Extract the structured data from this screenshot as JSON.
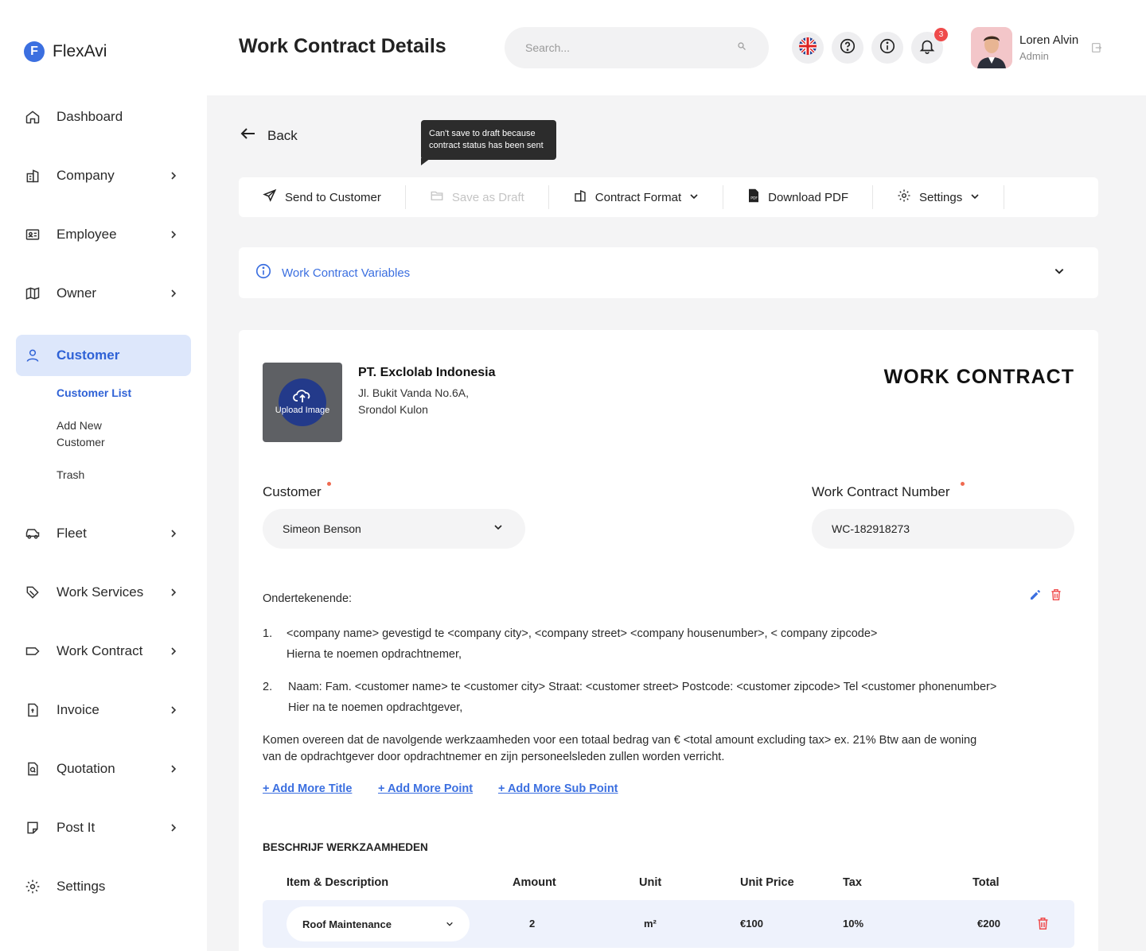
{
  "app": {
    "logo_letter": "F",
    "name": "FlexAvi"
  },
  "sidebar": {
    "items": [
      {
        "label": "Dashboard",
        "icon": "home-icon"
      },
      {
        "label": "Company",
        "icon": "building-icon"
      },
      {
        "label": "Employee",
        "icon": "id-card-icon"
      },
      {
        "label": "Owner",
        "icon": "map-icon"
      },
      {
        "label": "Customer",
        "icon": "user-icon"
      },
      {
        "label": "Fleet",
        "icon": "car-icon"
      },
      {
        "label": "Work Services",
        "icon": "tag-tools-icon"
      },
      {
        "label": "Work Contract",
        "icon": "label-icon"
      },
      {
        "label": "Invoice",
        "icon": "invoice-icon"
      },
      {
        "label": "Quotation",
        "icon": "quotation-icon"
      },
      {
        "label": "Post It",
        "icon": "note-icon"
      },
      {
        "label": "Settings",
        "icon": "gear-icon"
      }
    ],
    "customer_sub": [
      "Customer List",
      "Add New",
      "Customer",
      "Trash"
    ]
  },
  "header": {
    "title": "Work Contract Details",
    "search_placeholder": "Search...",
    "notification_count": "3",
    "user_name": "Loren Alvin",
    "user_role": "Admin"
  },
  "page": {
    "back_label": "Back",
    "tooltip": [
      "Can't save to draft because",
      "contract status has been sent"
    ],
    "toolbar": {
      "send": "Send to Customer",
      "draft": "Save as Draft",
      "format": "Contract Format",
      "download": "Download PDF",
      "settings": "Settings"
    },
    "variables_label": "Work Contract Variables"
  },
  "contract": {
    "upload_label": "Upload Image",
    "company_name": "PT. Exclolab Indonesia",
    "company_address": [
      "Jl. Bukit Vanda No.6A,",
      "Srondol Kulon"
    ],
    "title": "WORK CONTRACT",
    "customer_label": "Customer",
    "customer_value": "Simeon Benson",
    "number_label": "Work Contract Number",
    "number_value": "WC-182918273",
    "intro": "Ondertekenende:",
    "points": [
      {
        "num": "1.",
        "line1": "<company name> gevestigd te <company city>, <company street> <company housenumber>, < company zipcode>",
        "line2": "Hierna te noemen opdrachtnemer,"
      },
      {
        "num": "2.",
        "line1": "Naam: Fam. <customer name> te <customer city> Straat: <customer street> Postcode: <customer zipcode> Tel <customer phonenumber>",
        "line2": "Hier na te noemen opdrachtgever,"
      }
    ],
    "agreement": [
      "Komen overeen dat de navolgende werkzaamheden voor een totaal bedrag van  €  <total amount excluding tax> ex. 21% Btw  aan de woning",
      "van de opdrachtgever door opdrachtnemer en zijn personeelsleden zullen worden verricht."
    ],
    "add_links": [
      "+ Add More Title",
      "+ Add More Point",
      "+ Add More Sub Point"
    ],
    "section_title": "BESCHRIJF WERKZAAMHEDEN",
    "table": {
      "headers": [
        "Item & Description",
        "Amount",
        "Unit",
        "Unit Price",
        "Tax",
        "Total"
      ],
      "rows": [
        {
          "item": "Roof Maintenance",
          "amount": "2",
          "unit": "m²",
          "unit_price": "€100",
          "tax": "10%",
          "total": "€200"
        }
      ]
    }
  },
  "colors": {
    "accent": "#3b6fe0",
    "danger": "#ef4b4b",
    "active_bg": "#dde7fb"
  }
}
